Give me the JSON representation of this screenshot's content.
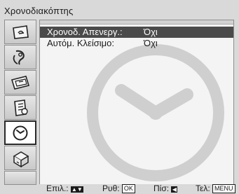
{
  "screen_title": "Χρονοδιακόπτης",
  "sidebar": {
    "items": [
      {
        "name": "picture-menu",
        "icon": "picture-icon"
      },
      {
        "name": "sound-menu",
        "icon": "sound-icon"
      },
      {
        "name": "screen-control-menu",
        "icon": "screen-control-icon"
      },
      {
        "name": "setup-menu",
        "icon": "setup-icon"
      },
      {
        "name": "timer-menu",
        "icon": "clock-icon",
        "active": true
      },
      {
        "name": "pc-settings-menu",
        "icon": "pc-icon"
      }
    ]
  },
  "menu": {
    "rows": [
      {
        "label": "Χρονοδ. Απενεργ.:",
        "value": "Όχι"
      },
      {
        "label": "Αυτόμ. Κλείσιμο:",
        "value": "Όχι"
      }
    ]
  },
  "footer": {
    "select_label": "Επιλ.:",
    "select_key": "▲▼",
    "set_label": "Ρυθ:",
    "set_key": "OK",
    "back_label": "Πίσ:",
    "back_key": "◀",
    "exit_label": "Τελ:",
    "exit_key": "MENU"
  },
  "colors": {
    "background": "#d9d9d9",
    "selection": "#4a4a4a",
    "panel": "#f4f4f4",
    "watermark": "#cfcfcf"
  }
}
